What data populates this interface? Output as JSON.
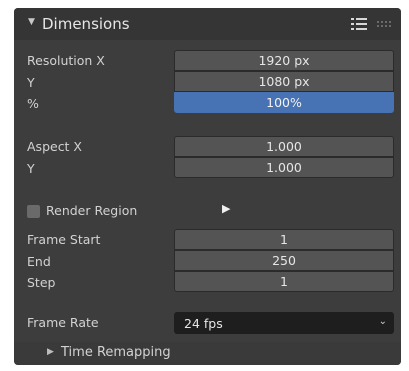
{
  "panel": {
    "title": "Dimensions",
    "collapse_icon": "triangle-down-icon",
    "list_icon": "list-icon",
    "grip_icon": "drag-grip-icon"
  },
  "resolution": {
    "x_label": "Resolution X",
    "x_value": "1920 px",
    "y_label": "Y",
    "y_value": "1080 px",
    "pct_label": "%",
    "pct_value": "100%"
  },
  "aspect": {
    "x_label": "Aspect X",
    "x_value": "1.000",
    "y_label": "Y",
    "y_value": "1.000"
  },
  "render_region": {
    "label": "Render Region",
    "checked": false,
    "play_icon": "triangle-right-icon"
  },
  "frames": {
    "start_label": "Frame Start",
    "start_value": "1",
    "end_label": "End",
    "end_value": "250",
    "step_label": "Step",
    "step_value": "1"
  },
  "frame_rate": {
    "label": "Frame Rate",
    "value": "24 fps"
  },
  "time_remapping": {
    "label": "Time Remapping"
  },
  "colors": {
    "accent": "#4772b3",
    "panel_bg": "#3d3d3d",
    "field_bg": "#545454"
  }
}
